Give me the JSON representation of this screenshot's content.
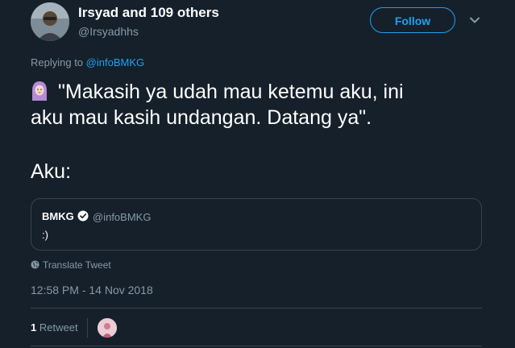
{
  "author": {
    "display_name": "Irsyad and 109 others",
    "handle": "@Irsyadhhs",
    "avatar_icon": "user-avatar"
  },
  "follow_label": "Follow",
  "more_icon": "chevron-down-icon",
  "reply": {
    "prefix": "Replying to ",
    "target": "@infoBMKG"
  },
  "tweet": {
    "emoji_icon": "woman-with-headscarf-emoji",
    "line1": "\"Makasih ya udah mau ketemu aku, ini",
    "line2": "aku mau kasih undangan. Datang ya\".",
    "line3": "Aku:"
  },
  "quoted": {
    "name": "BMKG",
    "verified_icon": "verified-badge-icon",
    "handle": "@infoBMKG",
    "text": ":)"
  },
  "translate_label": "Translate Tweet",
  "timestamp": "12:58 PM - 14 Nov 2018",
  "retweets": {
    "count": "1",
    "label": "Retweet"
  },
  "colors": {
    "background": "#15202b",
    "accent": "#1da1f2",
    "muted": "#8899a6",
    "border": "#38444d"
  }
}
